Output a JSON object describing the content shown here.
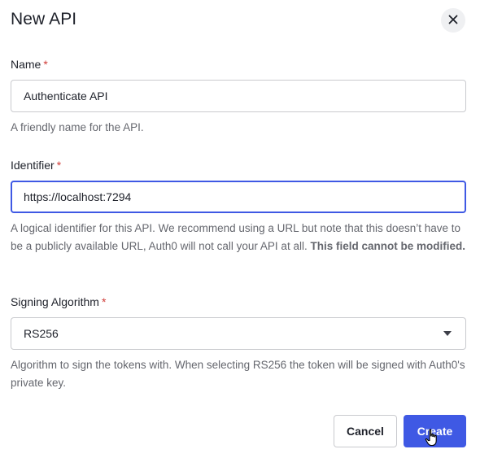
{
  "dialog": {
    "title": "New API",
    "close_icon": "close-icon"
  },
  "fields": {
    "name": {
      "label": "Name",
      "required_mark": "*",
      "value": "Authenticate API",
      "help": "A friendly name for the API."
    },
    "identifier": {
      "label": "Identifier",
      "required_mark": "*",
      "value": "https://localhost:7294",
      "help": "A logical identifier for this API. We recommend using a URL but note that this doesn’t have to be a publicly available URL, Auth0 will not call your API at all. ",
      "help_bold": "This field cannot be modified."
    },
    "signing_algorithm": {
      "label": "Signing Algorithm",
      "required_mark": "*",
      "selected": "RS256",
      "help": "Algorithm to sign the tokens with. When selecting RS256 the token will be signed with Auth0's private key."
    }
  },
  "actions": {
    "cancel_label": "Cancel",
    "create_label": "Create"
  },
  "colors": {
    "primary": "#3f59e4",
    "required": "#d03c38",
    "help_text": "#65676e"
  }
}
